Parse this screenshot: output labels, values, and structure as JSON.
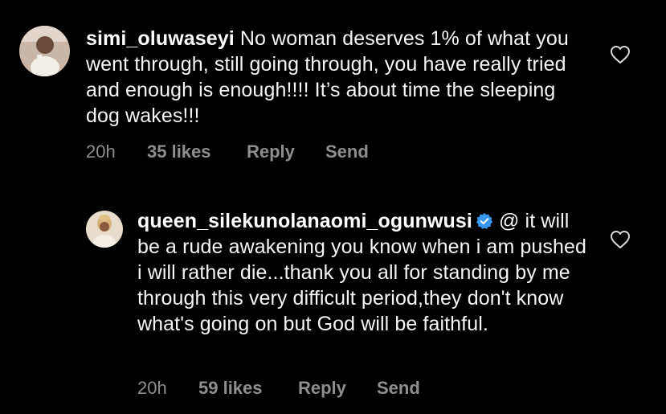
{
  "comments": [
    {
      "username": "simi_oluwaseyi",
      "body": "No woman deserves 1% of what you went through, still going through, you have really tried and enough is enough!!!! It’s about time the sleeping dog wakes!!!",
      "time": "20h",
      "likes": "35 likes",
      "reply_label": "Reply",
      "send_label": "Send"
    },
    {
      "username": "queen_silekunolanaomi_ogunwusi",
      "verified": true,
      "body": "@ it will be a rude awakening you know when i am pushed i will rather die...thank you all for standing by me through this very difficult period,they don't know what's going on but God will be faithful.",
      "time": "20h",
      "likes": "59 likes",
      "reply_label": "Reply",
      "send_label": "Send"
    }
  ],
  "colors": {
    "background": "#000000",
    "text": "#f5f5f5",
    "meta": "#8e8e8e",
    "verified": "#3897f0"
  }
}
